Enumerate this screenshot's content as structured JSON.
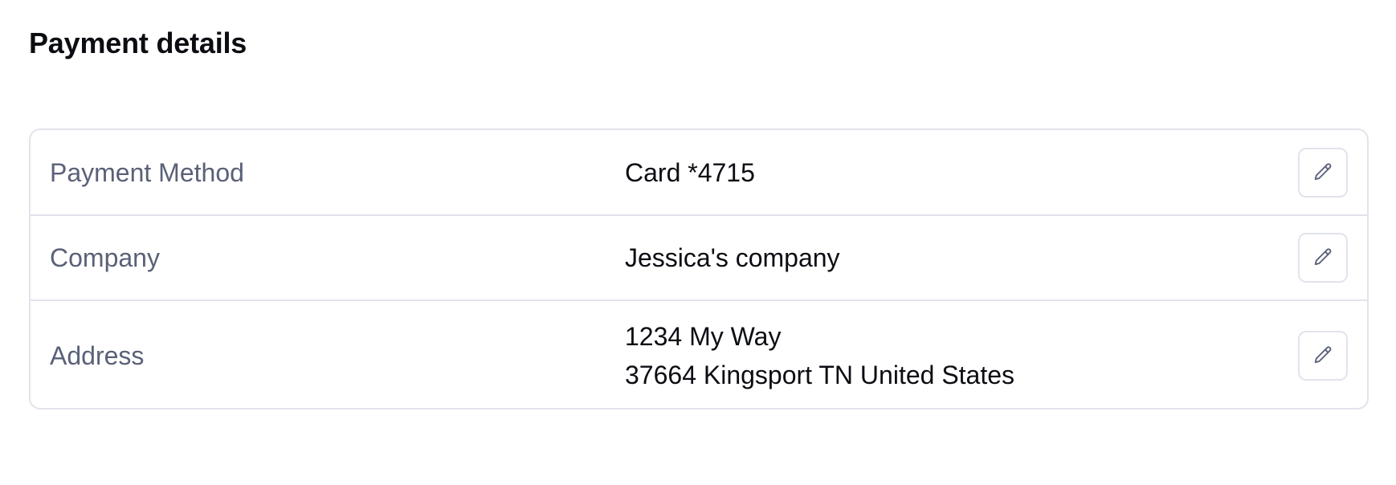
{
  "page": {
    "title": "Payment details"
  },
  "rows": [
    {
      "label": "Payment Method",
      "value": "Card *4715",
      "action_icon": "pencil-icon"
    },
    {
      "label": "Company",
      "value": "Jessica's company",
      "action_icon": "pencil-icon"
    },
    {
      "label": "Address",
      "value_lines": [
        "1234 My Way",
        "37664 Kingsport TN United States"
      ],
      "action_icon": "pencil-icon"
    }
  ],
  "colors": {
    "title_text": "#0b0d12",
    "label_text": "#5a6178",
    "value_text": "#0b0d12",
    "border": "#e2e4ec",
    "icon": "#5a6178"
  }
}
